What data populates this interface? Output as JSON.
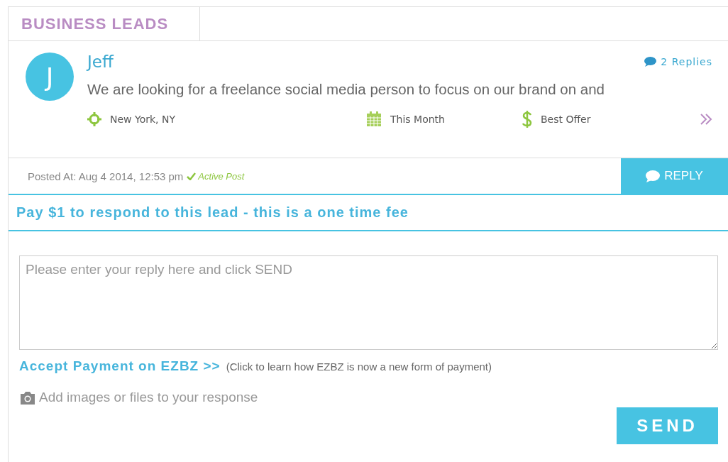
{
  "section_tab": "BUSINESS LEADS",
  "post": {
    "avatar_letter": "J",
    "author": "Jeff",
    "replies": "2 Replies",
    "message": "We are looking for a freelance social media person to focus on our brand on and",
    "meta": [
      {
        "kind": "location",
        "text": "New York, NY"
      },
      {
        "kind": "date",
        "text": "This Month"
      },
      {
        "kind": "price",
        "text": "Best Offer"
      }
    ],
    "posted_at": "Posted At: Aug 4 2014, 12:53 pm",
    "status": "Active Post",
    "active": true,
    "reply_button": "REPLY"
  },
  "pay_notice": "Pay $1 to respond to this lead - this is a one time fee",
  "reply_form": {
    "placeholder": "Please enter your reply here and click SEND",
    "payment_link": "Accept Payment on EZBZ >>",
    "payment_note": "(Click to learn how EZBZ is now a new form of payment)",
    "attach": "Add images or files to your response",
    "send_button": "SEND"
  }
}
